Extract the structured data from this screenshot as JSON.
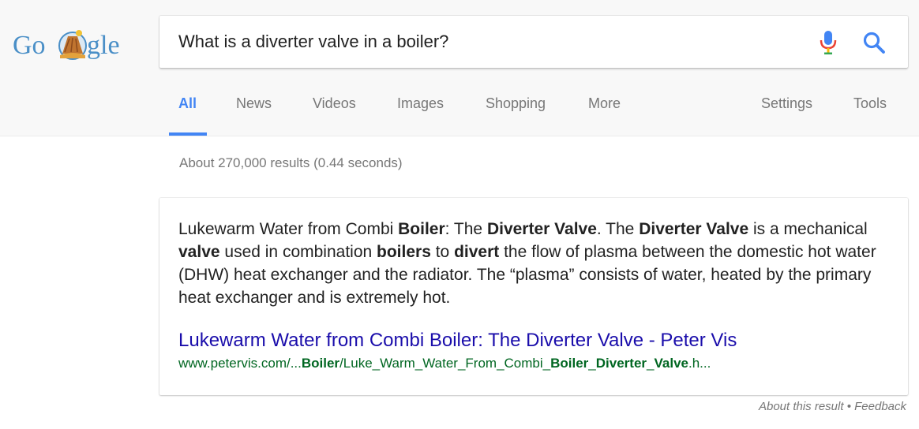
{
  "header": {
    "logo": {
      "letters_left": "Go",
      "letters_right": "gle"
    },
    "search": {
      "query": "What is a diverter valve in a boiler?",
      "mic_icon": "microphone-icon",
      "search_icon": "magnifier-icon"
    },
    "tabs": [
      {
        "label": "All",
        "active": true
      },
      {
        "label": "News"
      },
      {
        "label": "Videos"
      },
      {
        "label": "Images"
      },
      {
        "label": "Shopping"
      },
      {
        "label": "More"
      }
    ],
    "right_tabs": [
      {
        "label": "Settings"
      },
      {
        "label": "Tools"
      }
    ]
  },
  "result_stats": "About 270,000 results (0.44 seconds)",
  "snippet": {
    "segments": [
      {
        "text": "Lukewarm Water from Combi ",
        "bold": false
      },
      {
        "text": "Boiler",
        "bold": true
      },
      {
        "text": ": The ",
        "bold": false
      },
      {
        "text": "Diverter Valve",
        "bold": true
      },
      {
        "text": ". The ",
        "bold": false
      },
      {
        "text": "Diverter Valve",
        "bold": true
      },
      {
        "text": " is a mechanical ",
        "bold": false
      },
      {
        "text": "valve",
        "bold": true
      },
      {
        "text": " used in combination ",
        "bold": false
      },
      {
        "text": "boilers",
        "bold": true
      },
      {
        "text": " to ",
        "bold": false
      },
      {
        "text": "divert",
        "bold": true
      },
      {
        "text": " the flow of plasma between the domestic hot water (DHW) heat exchanger and the radiator. The “plasma” consists of water, heated by the primary heat exchanger and is extremely hot.",
        "bold": false
      }
    ],
    "title": "Lukewarm Water from Combi Boiler: The Diverter Valve - Peter Vis",
    "url_segments": [
      {
        "text": "www.petervis.com/...",
        "bold": false
      },
      {
        "text": "Boiler",
        "bold": true
      },
      {
        "text": "/Luke_Warm_Water_From_Combi_",
        "bold": false
      },
      {
        "text": "Boiler",
        "bold": true
      },
      {
        "text": "_",
        "bold": false
      },
      {
        "text": "Diverter",
        "bold": true
      },
      {
        "text": "_",
        "bold": false
      },
      {
        "text": "Valve",
        "bold": true
      },
      {
        "text": ".h...",
        "bold": false
      }
    ]
  },
  "footer": {
    "about": "About this result",
    "separator": " • ",
    "feedback": "Feedback"
  },
  "colors": {
    "link": "#1a0dab",
    "url": "#006621",
    "active_tab": "#4285f4",
    "muted": "#777777"
  }
}
